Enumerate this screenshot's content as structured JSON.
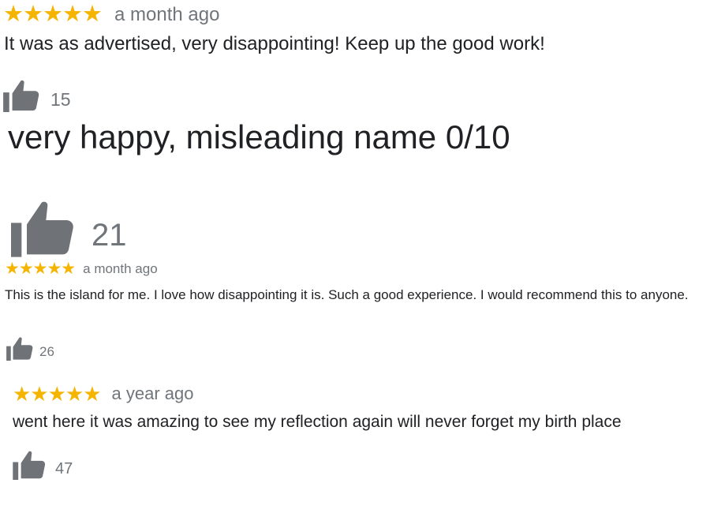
{
  "colors": {
    "star": "#f4b400",
    "muted": "#70757a",
    "thumb": "#6f7377",
    "text": "#202124"
  },
  "reviews": [
    {
      "rating": 5,
      "stars": "★★★★★",
      "time": "a month ago",
      "text": "It was as advertised, very disappointing! Keep up the good work!",
      "likes": "15"
    },
    {
      "text": "very happy, misleading name 0/10",
      "likes": "21"
    },
    {
      "rating": 5,
      "stars": "★★★★★",
      "time": "a month ago",
      "text": "This is the island for me. I love how disappointing it is. Such a good experience. I would recommend this to anyone.",
      "likes": "26"
    },
    {
      "rating": 5,
      "stars": "★★★★★",
      "time": "a year ago",
      "text": "went here it was amazing to see my reflection again will never forget my birth place",
      "likes": "47"
    }
  ],
  "icons": {
    "star": "star-icon",
    "like": "thumbs-up-icon"
  }
}
